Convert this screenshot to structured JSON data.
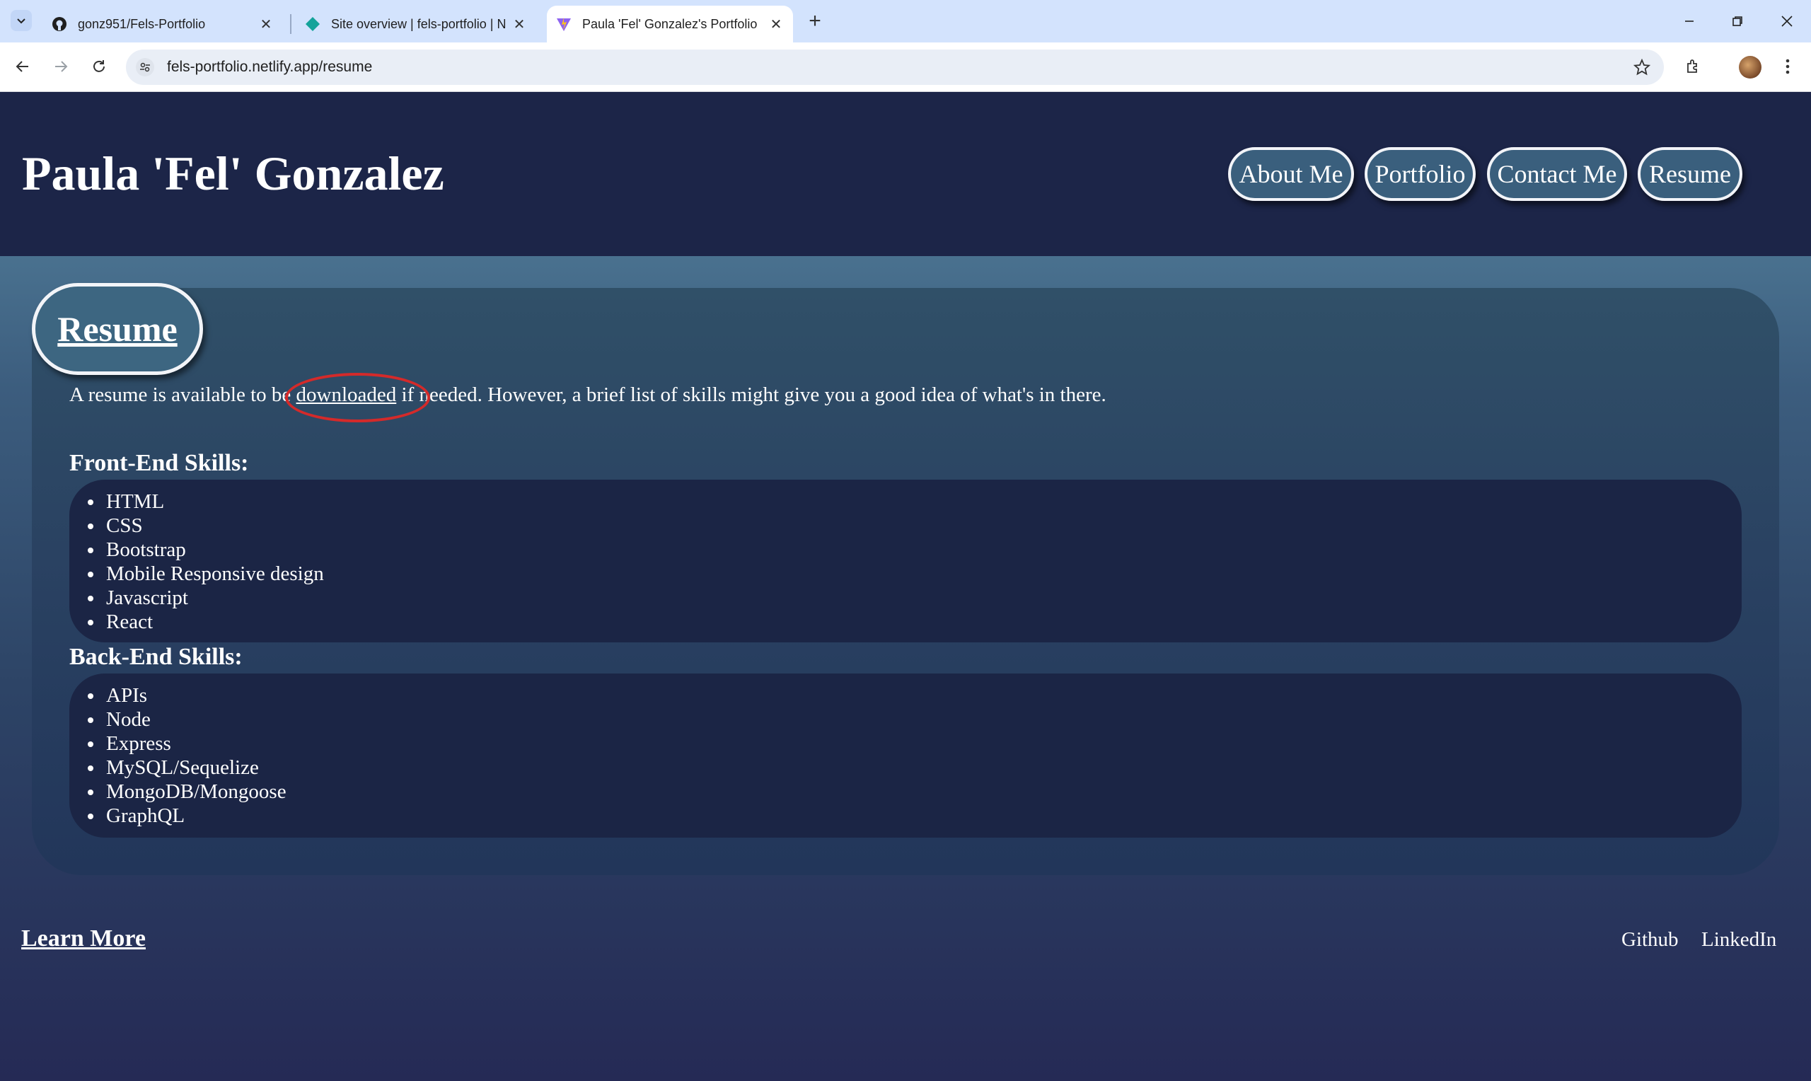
{
  "browser": {
    "tabs": [
      {
        "title": "gonz951/Fels-Portfolio",
        "icon": "github-icon"
      },
      {
        "title": "Site overview | fels-portfolio | N",
        "icon": "netlify-icon"
      },
      {
        "title": "Paula 'Fel' Gonzalez's Portfolio",
        "icon": "vite-icon"
      }
    ],
    "url": "fels-portfolio.netlify.app/resume"
  },
  "site": {
    "title": "Paula 'Fel' Gonzalez",
    "nav": [
      "About Me",
      "Portfolio",
      "Contact Me",
      "Resume"
    ]
  },
  "resume": {
    "heading": "Resume",
    "intro_before": "A resume is available to be ",
    "intro_link": "downloaded",
    "intro_after": " if needed. However, a brief list of skills might give you a good idea of what's in there.",
    "frontend": {
      "heading": "Front-End Skills:",
      "items": [
        "HTML",
        "CSS",
        "Bootstrap",
        "Mobile Responsive design",
        "Javascript",
        "React"
      ]
    },
    "backend": {
      "heading": "Back-End Skills:",
      "items": [
        "APIs",
        "Node",
        "Express",
        "MySQL/Sequelize",
        "MongoDB/Mongoose",
        "GraphQL"
      ]
    }
  },
  "footer": {
    "learn_more": "Learn More",
    "links": [
      "Github",
      "LinkedIn"
    ]
  },
  "colors": {
    "header_bg": "#1c2548",
    "pill_bg": "#3a5f7d",
    "skill_box_bg": "#1b2545",
    "annotation_ring": "#d42a2a"
  }
}
